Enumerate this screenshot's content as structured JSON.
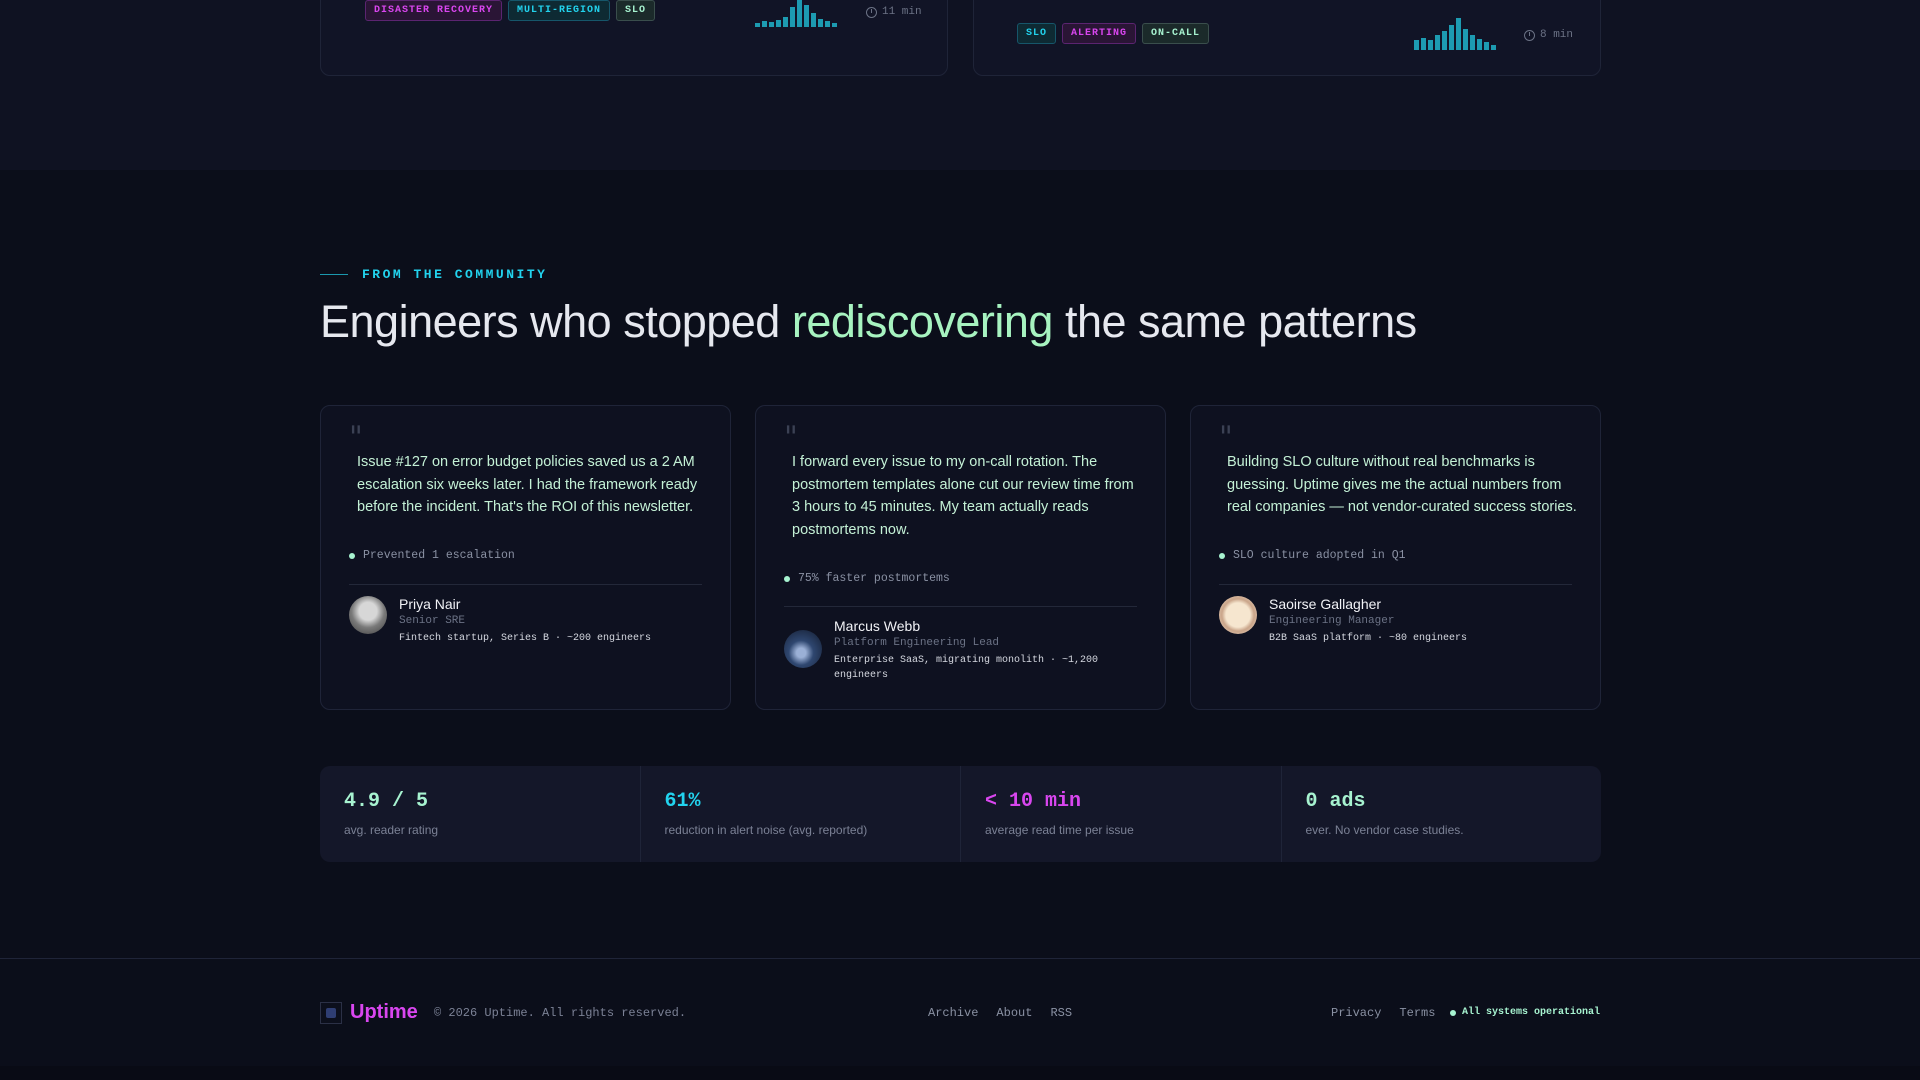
{
  "posts": [
    {
      "tags": [
        {
          "label": "DISASTER RECOVERY",
          "color": "#d946ef"
        },
        {
          "label": "MULTI-REGION",
          "color": "#22d3ee"
        },
        {
          "label": "SLO",
          "color": "#a7f3d0"
        }
      ],
      "read_time": "11 min"
    },
    {
      "tags": [
        {
          "label": "SLO",
          "color": "#22d3ee"
        },
        {
          "label": "ALERTING",
          "color": "#d946ef"
        },
        {
          "label": "ON-CALL",
          "color": "#a7f3d0"
        }
      ],
      "read_time": "8 min"
    }
  ],
  "community": {
    "eyebrow": "FROM THE COMMUNITY",
    "headline_pre": "Engineers who stopped ",
    "headline_highlight": "rediscovering",
    "headline_post": " the same patterns",
    "testimonials": [
      {
        "quote": "Issue #127 on error budget policies saved us a 2 AM escalation six weeks later. I had the framework ready before the incident. That's the ROI of this newsletter.",
        "metric": "Prevented 1 escalation",
        "name": "Priya Nair",
        "role": "Senior SRE",
        "company": "Fintech startup, Series B · ~200 engineers"
      },
      {
        "quote": "I forward every issue to my on-call rotation. The postmortem templates alone cut our review time from 3 hours to 45 minutes. My team actually reads postmortems now.",
        "metric": "75% faster postmortems",
        "name": "Marcus Webb",
        "role": "Platform Engineering Lead",
        "company": "Enterprise SaaS, migrating monolith · ~1,200 engineers"
      },
      {
        "quote": "Building SLO culture without real benchmarks is guessing. Uptime gives me the actual numbers from real companies — not vendor-curated success stories.",
        "metric": "SLO culture adopted in Q1",
        "name": "Saoirse Gallagher",
        "role": "Engineering Manager",
        "company": "B2B SaaS platform · ~80 engineers"
      }
    ]
  },
  "stats": [
    {
      "value": "4.9 / 5",
      "label": "avg. reader rating",
      "color": "#a7f3d0"
    },
    {
      "value": "61%",
      "label": "reduction in alert noise (avg. reported)",
      "color": "#22d3ee"
    },
    {
      "value": "< 10 min",
      "label": "average read time per issue",
      "color": "#d946ef"
    },
    {
      "value": "0 ads",
      "label": "ever. No vendor case studies.",
      "color": "#a7f3d0"
    }
  ],
  "footer": {
    "brand": "Uptime",
    "copyright": "© 2026 Uptime. All rights reserved.",
    "center_links": [
      "Archive",
      "About",
      "RSS"
    ],
    "right_links": [
      "Privacy",
      "Terms"
    ],
    "status": "All systems operational"
  },
  "colors": {
    "accent_cyan": "#22d3ee",
    "accent_magenta": "#d946ef",
    "accent_mint": "#a7f3d0",
    "background": "#0b0e1a"
  }
}
